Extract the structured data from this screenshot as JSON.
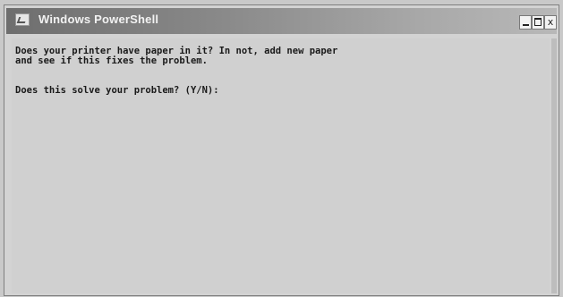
{
  "window": {
    "title": "Windows PowerShell",
    "icon": "powershell-icon"
  },
  "controls": {
    "minimize_icon": "minimize-icon",
    "maximize_icon": "maximize-icon",
    "close_label": "x"
  },
  "console": {
    "lines": [
      "Does your printer have paper in it? In not, add new paper",
      "and see if this fixes the problem.",
      "",
      "Does this solve your problem? (Y/N):"
    ]
  }
}
